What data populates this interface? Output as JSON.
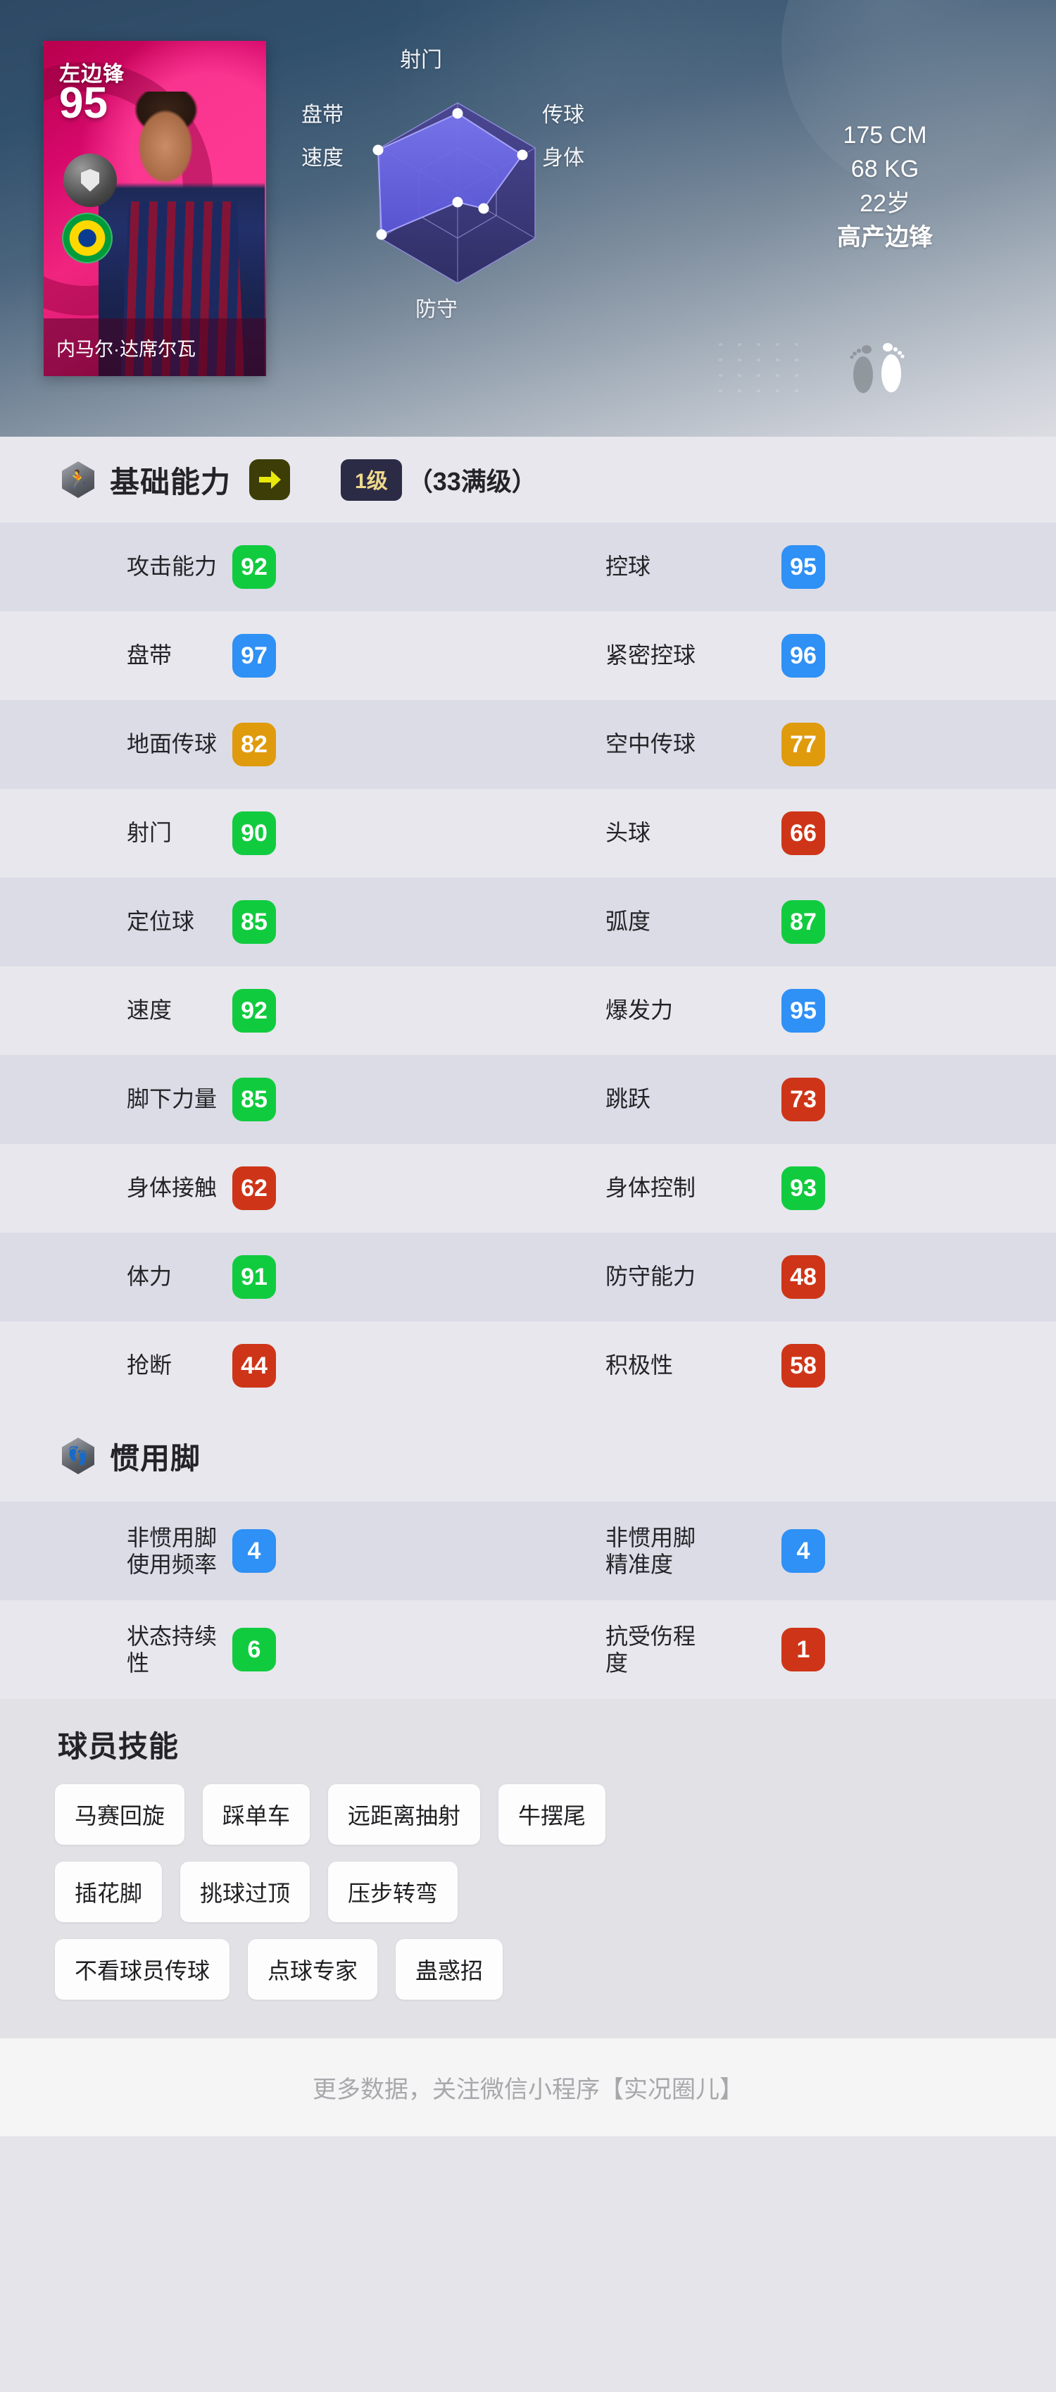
{
  "hero": {
    "card": {
      "position": "左边锋",
      "rating": "95",
      "name": "内马尔·达席尔瓦"
    },
    "physical": {
      "height": "175 CM",
      "weight": "68 KG",
      "age": "22岁",
      "role": "高产边锋"
    },
    "radar": {
      "labels": [
        "射门",
        "传球",
        "身体",
        "防守",
        "速度",
        "盘带"
      ]
    }
  },
  "chart_data": {
    "type": "radar",
    "title": "",
    "categories": [
      "射门",
      "传球",
      "身体",
      "防守",
      "速度",
      "盘带"
    ],
    "values": [
      88,
      84,
      34,
      10,
      92,
      95
    ],
    "rmax": 100,
    "grid": true,
    "legend": "none"
  },
  "basic": {
    "icon": "player-run-hex-icon",
    "title": "基础能力",
    "arrow_icon": "arrow-right-icon",
    "level_badge": "1级",
    "level_max": "（33满级）",
    "rows": [
      [
        {
          "label": "攻击能力",
          "value": "92",
          "color": "#11cb3f"
        },
        {
          "label": "控球",
          "value": "95",
          "color": "#2f90f5"
        }
      ],
      [
        {
          "label": "盘带",
          "value": "97",
          "color": "#2f90f5"
        },
        {
          "label": "紧密控球",
          "value": "96",
          "color": "#2f90f5"
        }
      ],
      [
        {
          "label": "地面传球",
          "value": "82",
          "color": "#e09b0d"
        },
        {
          "label": "空中传球",
          "value": "77",
          "color": "#e09b0d"
        }
      ],
      [
        {
          "label": "射门",
          "value": "90",
          "color": "#11cb3f"
        },
        {
          "label": "头球",
          "value": "66",
          "color": "#ce3518"
        }
      ],
      [
        {
          "label": "定位球",
          "value": "85",
          "color": "#11cb3f"
        },
        {
          "label": "弧度",
          "value": "87",
          "color": "#11cb3f"
        }
      ],
      [
        {
          "label": "速度",
          "value": "92",
          "color": "#11cb3f"
        },
        {
          "label": "爆发力",
          "value": "95",
          "color": "#2f90f5"
        }
      ],
      [
        {
          "label": "脚下力量",
          "value": "85",
          "color": "#11cb3f"
        },
        {
          "label": "跳跃",
          "value": "73",
          "color": "#ce3518"
        }
      ],
      [
        {
          "label": "身体接触",
          "value": "62",
          "color": "#ce3518"
        },
        {
          "label": "身体控制",
          "value": "93",
          "color": "#11cb3f"
        }
      ],
      [
        {
          "label": "体力",
          "value": "91",
          "color": "#11cb3f"
        },
        {
          "label": "防守能力",
          "value": "48",
          "color": "#ce3518"
        }
      ],
      [
        {
          "label": "抢断",
          "value": "44",
          "color": "#ce3518"
        },
        {
          "label": "积极性",
          "value": "58",
          "color": "#ce3518"
        }
      ]
    ]
  },
  "foot": {
    "icon": "footprint-hex-icon",
    "title": "惯用脚",
    "rows": [
      [
        {
          "label": "非惯用脚\n使用频率",
          "value": "4",
          "color": "#2f90f5"
        },
        {
          "label": "非惯用脚\n精准度",
          "value": "4",
          "color": "#2f90f5"
        }
      ],
      [
        {
          "label": "状态持续\n性",
          "value": "6",
          "color": "#11cb3f"
        },
        {
          "label": "抗受伤程\n度",
          "value": "1",
          "color": "#ce3518"
        }
      ]
    ]
  },
  "skills": {
    "title": "球员技能",
    "lines": [
      [
        "马赛回旋",
        "踩单车",
        "远距离抽射",
        "牛摆尾"
      ],
      [
        "插花脚",
        "挑球过顶",
        "压步转弯"
      ],
      [
        "不看球员传球",
        "点球专家",
        "蛊惑招"
      ]
    ]
  },
  "footer": {
    "text": "更多数据，关注微信小程序【实况圈儿】"
  }
}
